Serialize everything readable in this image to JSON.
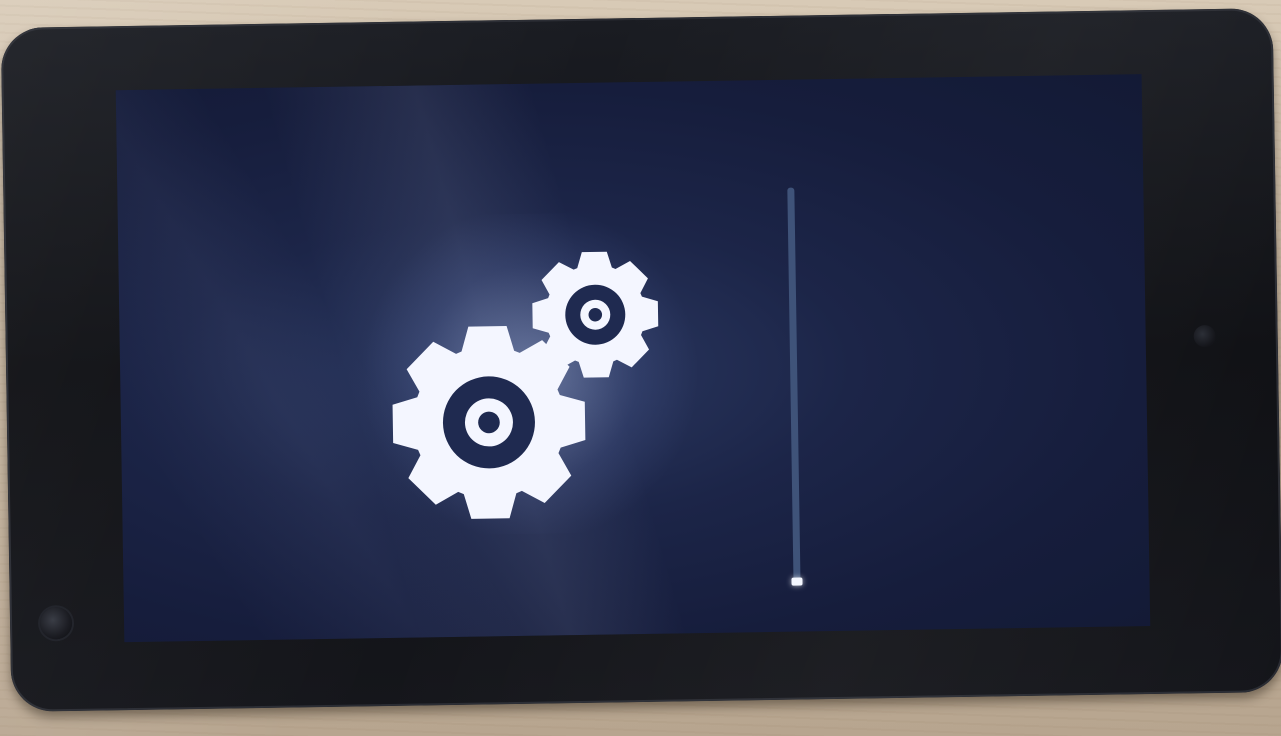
{
  "scene": {
    "description_icons": [
      "gears-icon",
      "progress-bar"
    ]
  },
  "screen": {
    "background_color": "#1c2548",
    "icon": "gears-icon",
    "icon_color": "#f4f6ff",
    "progress": {
      "value_fraction": 0.01,
      "track_color": "#3f5379",
      "fill_color": "#f4f7ff"
    }
  }
}
